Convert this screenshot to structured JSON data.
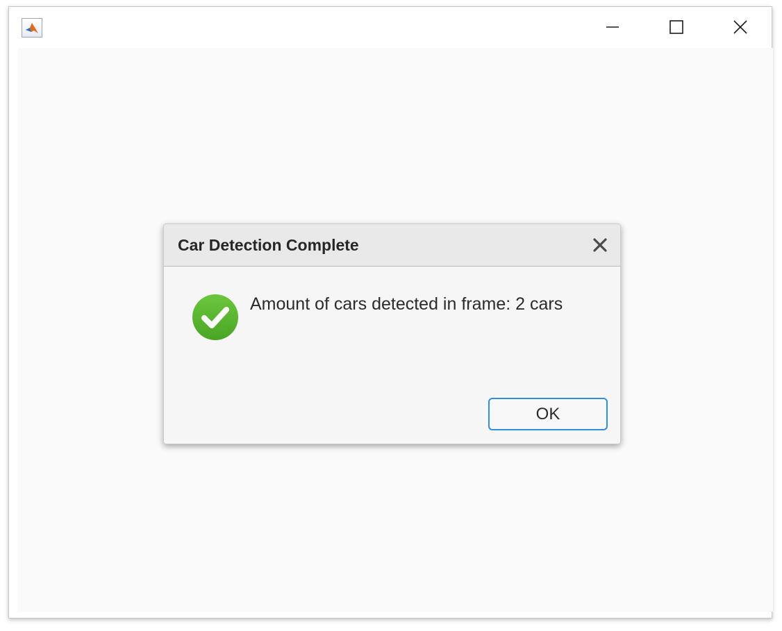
{
  "window": {
    "icon": "matlab-logo-icon",
    "controls": {
      "minimize_icon": "minimize-icon",
      "maximize_icon": "maximize-icon",
      "close_icon": "close-icon"
    }
  },
  "dialog": {
    "title": "Car Detection Complete",
    "close_icon": "close-icon",
    "status_icon": "success-check-icon",
    "message": "Amount of cars detected in frame: 2 cars",
    "ok_label": "OK"
  },
  "colors": {
    "success_green": "#5cb531",
    "button_border": "#2f8ee0"
  }
}
